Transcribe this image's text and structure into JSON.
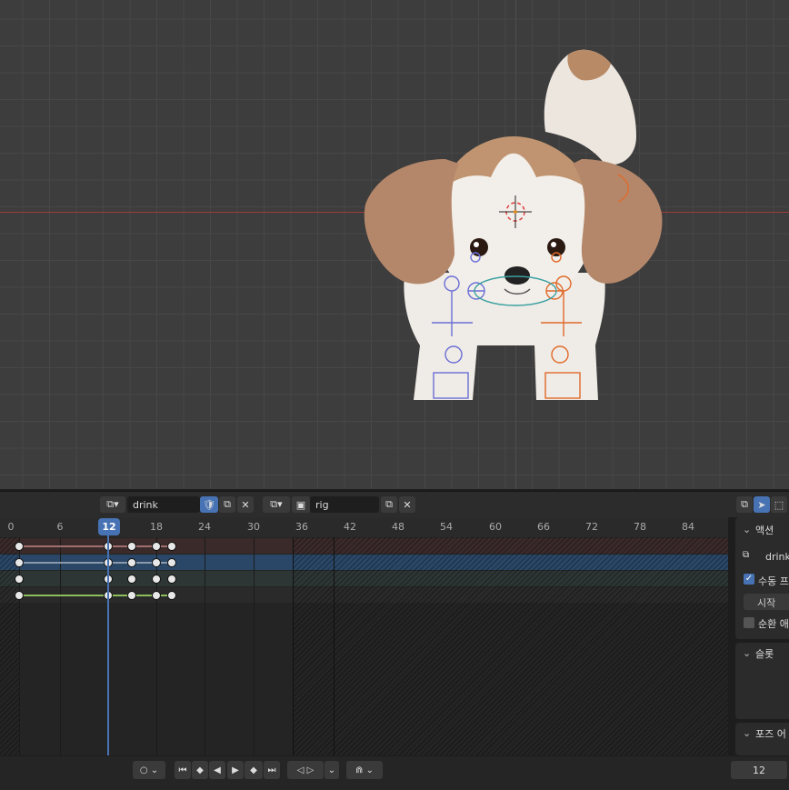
{
  "header": {
    "action_name": "drink",
    "object_name": "rig"
  },
  "timeline": {
    "ticks": [
      "0",
      "6",
      "12",
      "18",
      "24",
      "30",
      "36",
      "42",
      "48",
      "54",
      "60",
      "66",
      "72",
      "78",
      "84"
    ],
    "current_frame": "12"
  },
  "sidebar": {
    "action_panel_title": "액션",
    "action_field": "drink",
    "manual_frame_checkbox": "수동 프",
    "start_label": "시작",
    "cyclic_label": "순환 애",
    "slot_panel_title": "슬롯",
    "pose_panel_title": "포즈 어"
  },
  "footer": {
    "frame_value": "12"
  },
  "colors": {
    "accent": "#4772b3",
    "axis_x": "#a03a3a",
    "rig_blue": "#6b6fd6",
    "rig_orange": "#e06a2a",
    "rig_teal": "#3aa0a0"
  }
}
